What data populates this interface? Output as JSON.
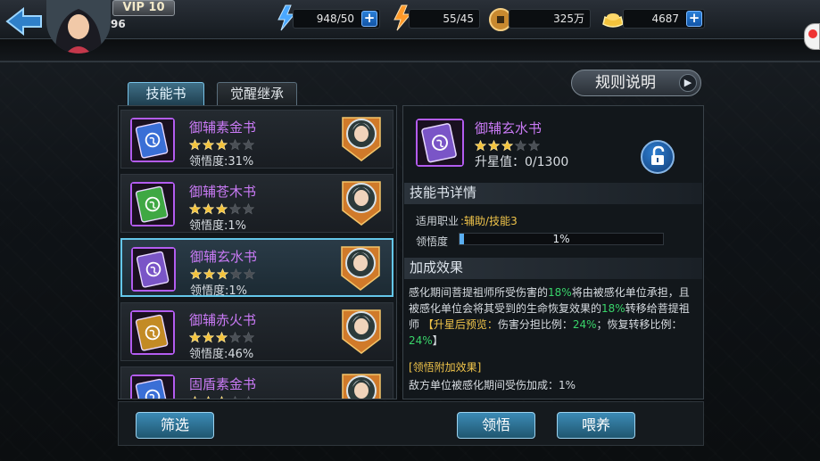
{
  "hud": {
    "vip": "VIP 10",
    "level": "96",
    "stamina": {
      "value": "948",
      "max": "/50"
    },
    "energy": {
      "value": "55",
      "max": "/45"
    },
    "coins": "325万",
    "gold": "4687"
  },
  "rules_button": "规则说明",
  "tabs": [
    {
      "label": "技能书"
    },
    {
      "label": "觉醒继承"
    }
  ],
  "books": [
    {
      "name": "御辅素金书",
      "stars": 3,
      "comprehension": "领悟度:31%",
      "color": "#3a6fd6"
    },
    {
      "name": "御辅苍木书",
      "stars": 3,
      "comprehension": "领悟度:1%",
      "color": "#3fa843"
    },
    {
      "name": "御辅玄水书",
      "stars": 3,
      "comprehension": "领悟度:1%",
      "color": "#7a55c7"
    },
    {
      "name": "御辅赤火书",
      "stars": 3,
      "comprehension": "领悟度:46%",
      "color": "#c38b25"
    },
    {
      "name": "固盾素金书",
      "stars": 3,
      "comprehension": "",
      "color": "#3a6fd6"
    }
  ],
  "selected": {
    "name": "御辅玄水书",
    "stars": 3,
    "star_value": "升星值：0/1300"
  },
  "details": {
    "header": "技能书详情",
    "job_label": "适用职业",
    "job_value": ":辅助/技能3",
    "comp_label": "领悟度",
    "comp_percent": "1%",
    "comp_fraction": 0.01
  },
  "effect": {
    "header": "加成效果",
    "line1_a": "感化期间菩提祖师所受伤害的",
    "line1_b": "18%",
    "line1_c": "将由被感化单位承担，且被感化单位会将其受到的生命恢复效果的",
    "line1_d": "18%",
    "line1_e": "转移给菩提祖师",
    "upgrade_a": "【升星后预览：",
    "upgrade_b": "伤害分担比例：",
    "upgrade_c": "24%",
    "upgrade_d": "；恢复转移比例：",
    "upgrade_e": "24%",
    "upgrade_f": "】",
    "extra_title": "[领悟附加效果]",
    "extra_desc": "敌方单位被感化期间受伤加成：1%"
  },
  "buttons": {
    "filter": "筛选",
    "comprehend": "领悟",
    "feed": "喂养"
  }
}
